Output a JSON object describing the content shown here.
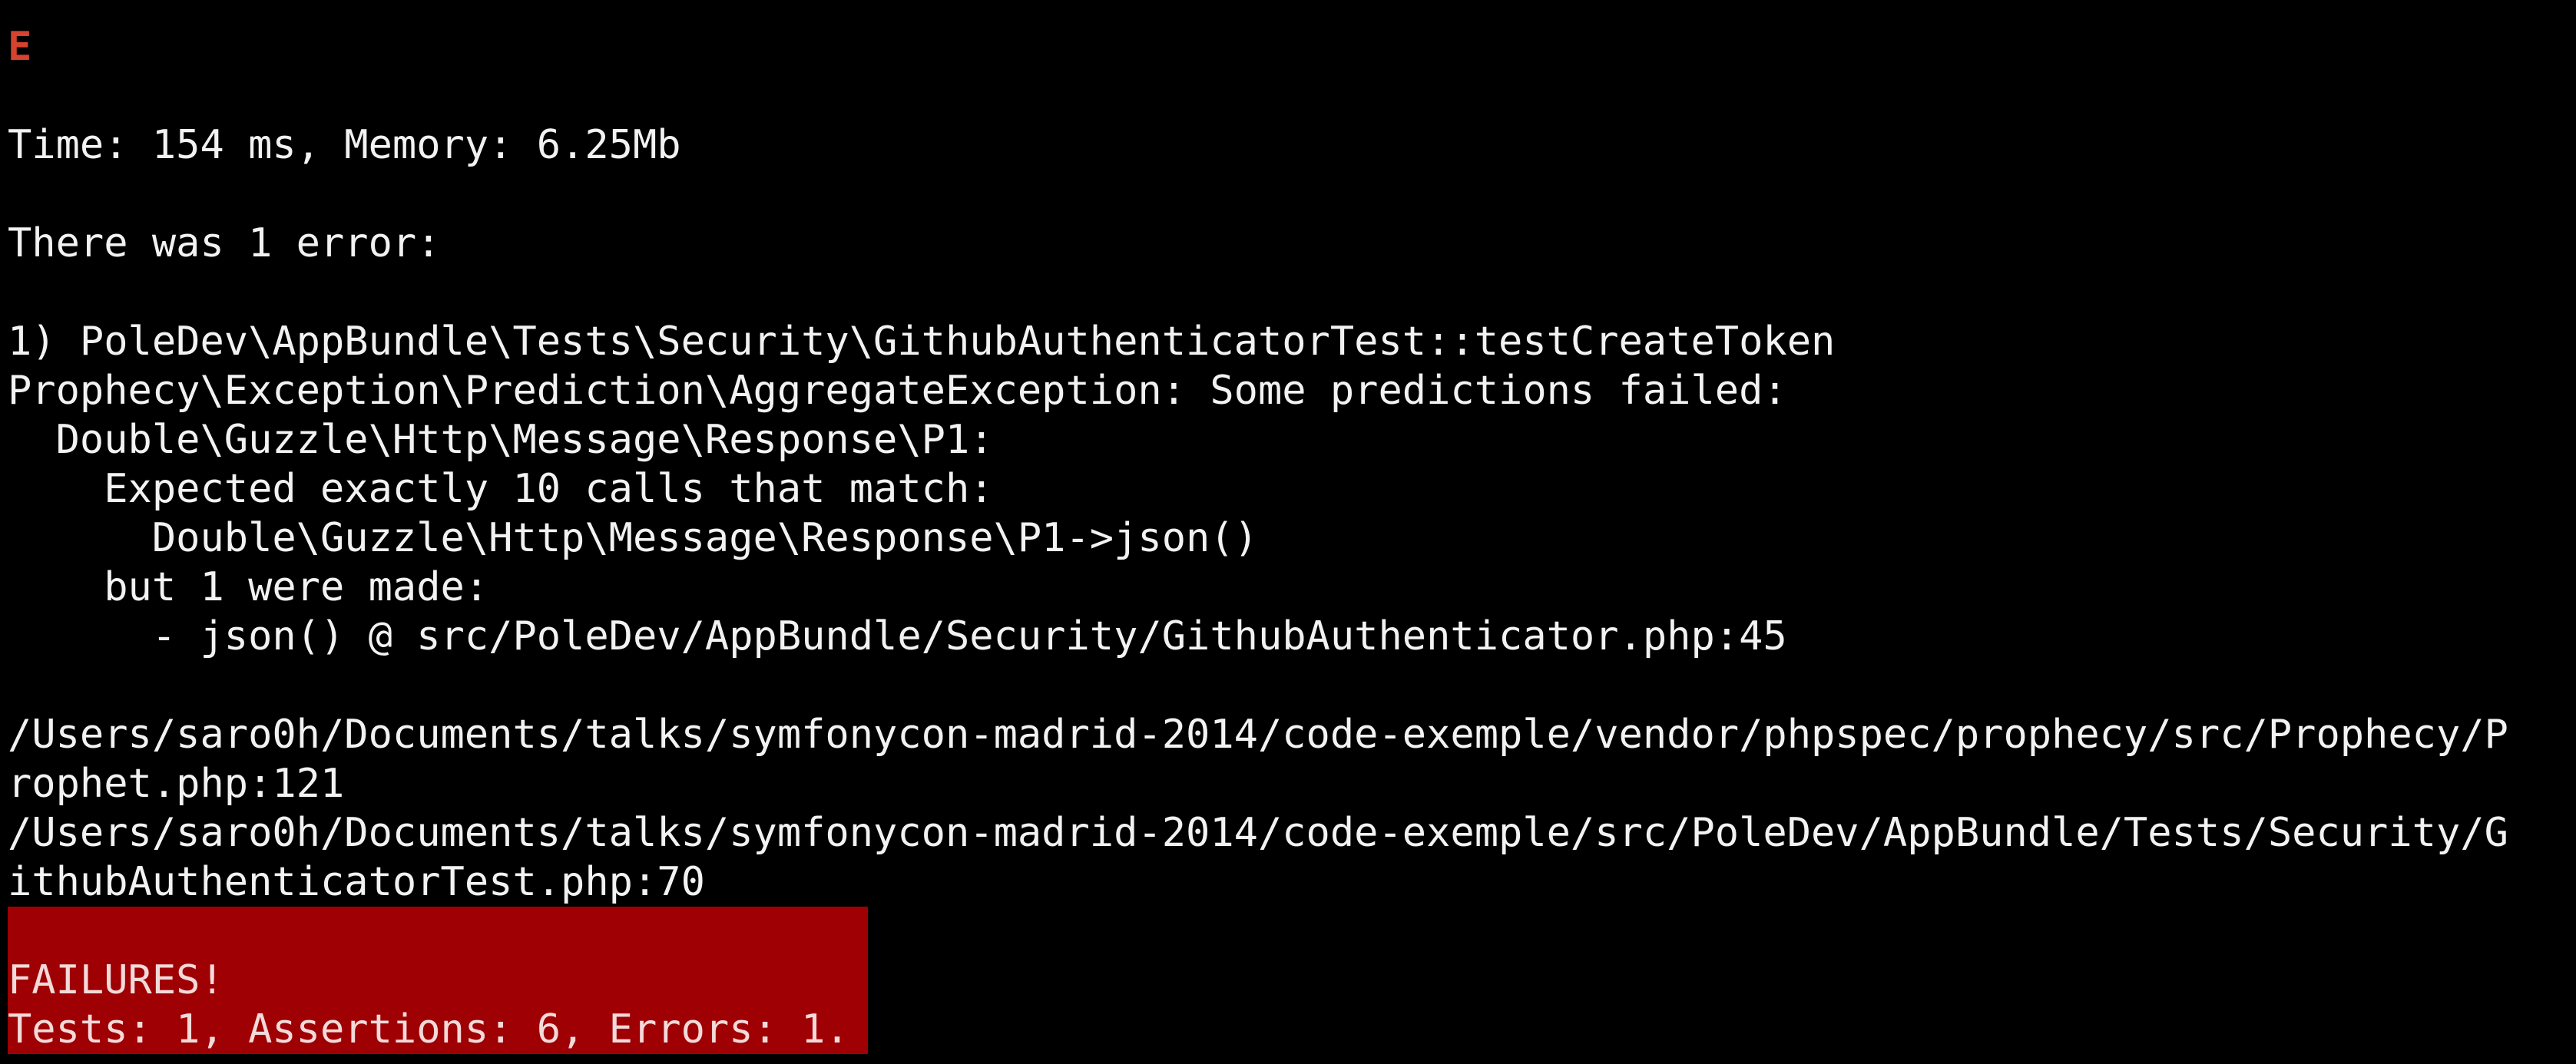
{
  "status_char": "E",
  "timing": "Time: 154 ms, Memory: 6.25Mb",
  "error_header": "There was 1 error:",
  "error": {
    "test_name": "1) PoleDev\\AppBundle\\Tests\\Security\\GithubAuthenticatorTest::testCreateToken",
    "exception": "Prophecy\\Exception\\Prediction\\AggregateException: Some predictions failed:",
    "double": "  Double\\Guzzle\\Http\\Message\\Response\\P1:",
    "expected": "    Expected exactly 10 calls that match:",
    "expected_call": "      Double\\Guzzle\\Http\\Message\\Response\\P1->json()",
    "made": "    but 1 were made:",
    "made_call": "      - json() @ src/PoleDev/AppBundle/Security/GithubAuthenticator.php:45"
  },
  "trace": [
    "/Users/saro0h/Documents/talks/symfonycon-madrid-2014/code-exemple/vendor/phpspec/prophecy/src/Prophecy/P",
    "rophet.php:121",
    "/Users/saro0h/Documents/talks/symfonycon-madrid-2014/code-exemple/src/PoleDev/AppBundle/Tests/Security/G",
    "ithubAuthenticatorTest.php:70"
  ],
  "summary": {
    "title": "FAILURES!",
    "counts": "Tests: 1, Assertions: 6, Errors: 1."
  },
  "colors": {
    "background": "#000000",
    "text": "#f2f2f2",
    "status_error": "#d6432e",
    "failure_bg": "#9f0003"
  }
}
